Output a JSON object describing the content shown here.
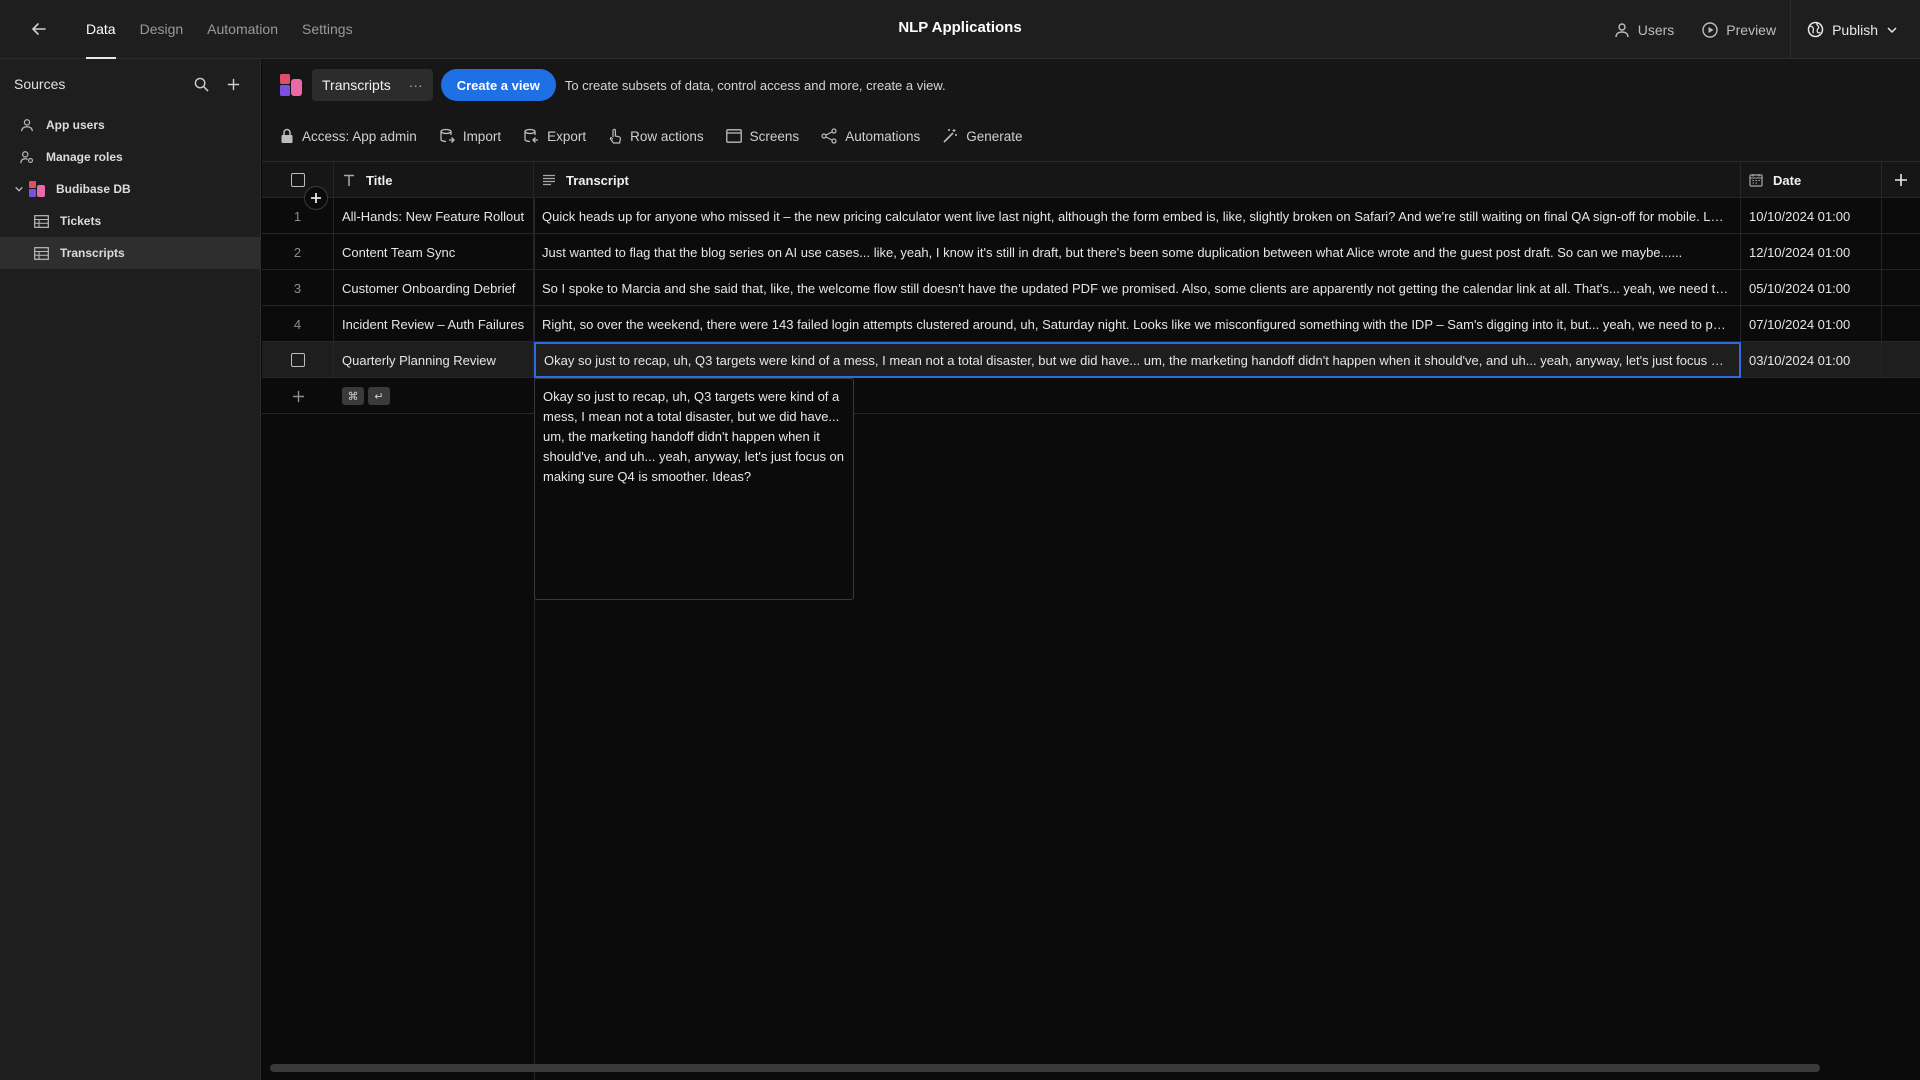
{
  "app_title": "NLP Applications",
  "nav": {
    "tabs": [
      {
        "label": "Data",
        "active": true
      },
      {
        "label": "Design",
        "active": false
      },
      {
        "label": "Automation",
        "active": false
      },
      {
        "label": "Settings",
        "active": false
      }
    ]
  },
  "top_actions": {
    "users": "Users",
    "preview": "Preview",
    "publish": "Publish"
  },
  "sidebar": {
    "title": "Sources",
    "items": [
      {
        "label": "App users",
        "icon": "user-icon"
      },
      {
        "label": "Manage roles",
        "icon": "roles-icon"
      },
      {
        "label": "Budibase DB",
        "icon": "budibase-logo"
      },
      {
        "label": "Tickets",
        "icon": "table-icon"
      },
      {
        "label": "Transcripts",
        "icon": "table-icon",
        "active": true
      }
    ]
  },
  "toolbar": {
    "table_name": "Transcripts",
    "more": "···",
    "create_view": "Create a view",
    "hint": "To create subsets of data, control access and more, create a view.",
    "access": "Access: App admin",
    "import": "Import",
    "export": "Export",
    "row_actions": "Row actions",
    "screens": "Screens",
    "automations": "Automations",
    "generate": "Generate"
  },
  "grid": {
    "columns": {
      "title": "Title",
      "transcript": "Transcript",
      "date": "Date"
    },
    "rows": [
      {
        "num": "1",
        "title": "All-Hands: New Feature Rollout",
        "transcript": "Quick heads up for anyone who missed it – the new pricing calculator went live last night, although the form embed is, like, slightly broken on Safari? And we're still waiting on final QA sign-off for mobile. Let's sync on this.",
        "date": "10/10/2024 01:00"
      },
      {
        "num": "2",
        "title": "Content Team Sync",
        "transcript": "Just wanted to flag that the blog series on AI use cases... like, yeah, I know it's still in draft, but there's been some duplication between what Alice wrote and the guest post draft. So can we maybe......",
        "date": "12/10/2024 01:00"
      },
      {
        "num": "3",
        "title": "Customer Onboarding Debrief",
        "transcript": "So I spoke to Marcia and she said that, like, the welcome flow still doesn't have the updated PDF we promised. Also, some clients are apparently not getting the calendar link at all. That's... yeah, we need to look into it.",
        "date": "05/10/2024 01:00"
      },
      {
        "num": "4",
        "title": "Incident Review – Auth Failures",
        "transcript": "Right, so over the weekend, there were 143 failed login attempts clustered around, uh, Saturday night. Looks like we misconfigured something with the IDP – Sam's digging into it, but... yeah, we need to patch it.",
        "date": "07/10/2024 01:00"
      },
      {
        "num": "",
        "title": "Quarterly Planning Review",
        "transcript": "Okay so just to recap, uh, Q3 targets were kind of a mess, I mean not a total disaster, but we did have... um, the marketing handoff didn't happen when it should've, and uh... yeah, anyway, let's just focus on making sure Q4 is smoother. Ideas?",
        "date": "03/10/2024 01:00"
      }
    ],
    "new_row_keys": [
      "⌘",
      "↵"
    ]
  },
  "popover_text": "Okay so just to recap, uh, Q3 targets were kind of a mess, I mean not a total disaster, but we did have... um, the marketing handoff didn't happen when it should've, and uh... yeah, anyway, let's just focus on making sure Q4 is smoother. Ideas?",
  "colors": {
    "accent": "#1f6fe5",
    "edit_border": "#2d6bdf"
  }
}
